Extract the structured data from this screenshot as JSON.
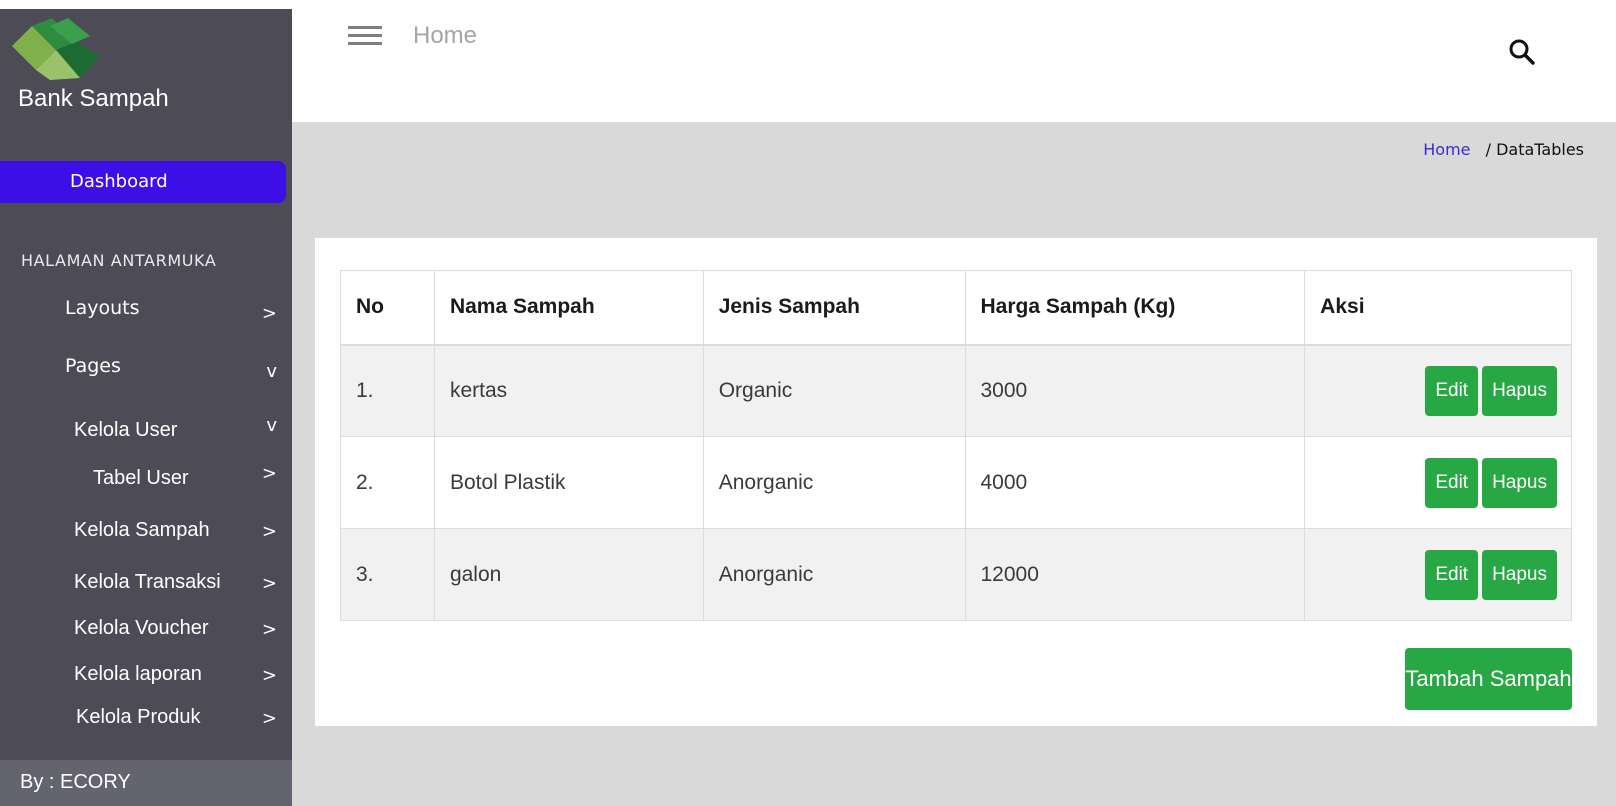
{
  "brand": {
    "name": "Bank Sampah",
    "logo_icon": "bank-sampah-logo"
  },
  "sidebar": {
    "dashboard_label": "Dashboard",
    "section_label": "HALAMAN ANTARMUKA",
    "items": [
      {
        "label": "Layouts",
        "chevron": ">"
      },
      {
        "label": "Pages",
        "chevron": "v"
      },
      {
        "label": "Kelola User",
        "chevron": "v"
      },
      {
        "label": "Tabel User",
        "chevron": ">"
      },
      {
        "label": "Kelola Sampah",
        "chevron": ">"
      },
      {
        "label": "Kelola Transaksi",
        "chevron": ">"
      },
      {
        "label": "Kelola Voucher",
        "chevron": ">"
      },
      {
        "label": "Kelola laporan",
        "chevron": ">"
      },
      {
        "label": "Kelola Produk",
        "chevron": ">"
      }
    ],
    "footer": "By : ECORY",
    "colors": {
      "background": "#4d4c56",
      "active": "#3d0ee6",
      "footer": "#646370"
    }
  },
  "topbar": {
    "title": "Home",
    "menu_icon": "hamburger-icon",
    "search_icon": "search-icon"
  },
  "breadcrumb": {
    "home": "Home",
    "current": "/ DataTables"
  },
  "table": {
    "headers": [
      "No",
      "Nama Sampah",
      "Jenis Sampah",
      "Harga Sampah (Kg)",
      "Aksi"
    ],
    "rows": [
      {
        "no": "1.",
        "nama": "kertas",
        "jenis": "Organic",
        "harga": "3000"
      },
      {
        "no": "2.",
        "nama": "Botol Plastik",
        "jenis": "Anorganic",
        "harga": "4000"
      },
      {
        "no": "3.",
        "nama": "galon",
        "jenis": "Anorganic",
        "harga": "12000"
      }
    ],
    "edit_label": "Edit",
    "delete_label": "Hapus"
  },
  "add_button_label": "Tambah Sampah",
  "accent_color": "#28a745"
}
